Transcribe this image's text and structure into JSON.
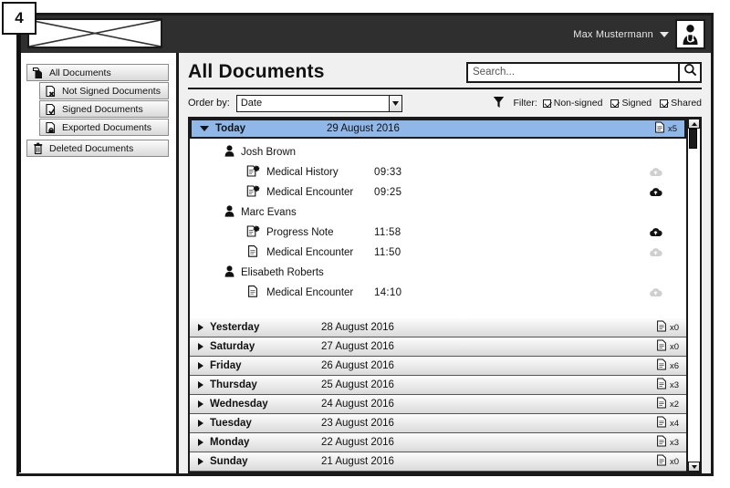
{
  "callout": {
    "number": "4"
  },
  "topbar": {
    "logo_placeholder": "image-placeholder",
    "user_name": "Max Mustermann",
    "avatar_icon": "doctor-avatar-icon",
    "caret_icon": "chevron-down-icon"
  },
  "sidebar": {
    "items": [
      {
        "label": "All Documents",
        "icon": "documents-stack-icon",
        "level": 0
      },
      {
        "label": "Not Signed Documents",
        "icon": "document-x-icon",
        "level": 1
      },
      {
        "label": "Signed Documents",
        "icon": "document-check-icon",
        "level": 1
      },
      {
        "label": "Exported Documents",
        "icon": "document-lock-icon",
        "level": 1
      },
      {
        "label": "Deleted Documents",
        "icon": "trash-bin-icon",
        "level": 0
      }
    ]
  },
  "main": {
    "page_title": "All Documents",
    "search": {
      "placeholder": "Search...",
      "value": "",
      "button_icon": "search-icon"
    },
    "order_by": {
      "label": "Order by:",
      "value": "Date",
      "arrow_icon": "chevron-down-icon"
    },
    "filter": {
      "icon": "filter-funnel-icon",
      "label": "Filter:",
      "options": [
        {
          "label": "Non-signed",
          "checked": true
        },
        {
          "label": "Signed",
          "checked": true
        },
        {
          "label": "Shared",
          "checked": true
        }
      ]
    },
    "scrollbar": {
      "up_icon": "scroll-up-icon",
      "down_icon": "scroll-down-icon"
    }
  },
  "days": [
    {
      "name": "Today",
      "date": "29 August 2016",
      "count": "x5",
      "count_icon": "document-icon",
      "expanded": true,
      "groups": [
        {
          "patient": "Josh Brown",
          "patient_icon": "person-icon",
          "documents": [
            {
              "name": "Medical History",
              "time": "09:33",
              "icon": "document-signed-icon",
              "cloud": "cloud-upload-icon",
              "shared": false
            },
            {
              "name": "Medical Encounter",
              "time": "09:25",
              "icon": "document-signed-icon",
              "cloud": "cloud-upload-icon",
              "shared": true
            }
          ]
        },
        {
          "patient": "Marc Evans",
          "patient_icon": "person-icon",
          "documents": [
            {
              "name": "Progress Note",
              "time": "11:58",
              "icon": "document-signed-icon",
              "cloud": "cloud-upload-icon",
              "shared": true
            },
            {
              "name": "Medical Encounter",
              "time": "11:50",
              "icon": "document-unsigned-icon",
              "cloud": "cloud-upload-icon",
              "shared": false
            }
          ]
        },
        {
          "patient": "Elisabeth Roberts",
          "patient_icon": "person-icon",
          "documents": [
            {
              "name": "Medical Encounter",
              "time": "14:10",
              "icon": "document-unsigned-icon",
              "cloud": "cloud-upload-icon",
              "shared": false
            }
          ]
        }
      ]
    },
    {
      "name": "Yesterday",
      "date": "28 August 2016",
      "count": "x0",
      "count_icon": "document-icon",
      "expanded": false,
      "groups": []
    },
    {
      "name": "Saturday",
      "date": "27 August 2016",
      "count": "x0",
      "count_icon": "document-icon",
      "expanded": false,
      "groups": []
    },
    {
      "name": "Friday",
      "date": "26 August 2016",
      "count": "x6",
      "count_icon": "document-icon",
      "expanded": false,
      "groups": []
    },
    {
      "name": "Thursday",
      "date": "25 August 2016",
      "count": "x3",
      "count_icon": "document-icon",
      "expanded": false,
      "groups": []
    },
    {
      "name": "Wednesday",
      "date": "24 August 2016",
      "count": "x2",
      "count_icon": "document-icon",
      "expanded": false,
      "groups": []
    },
    {
      "name": "Tuesday",
      "date": "23 August 2016",
      "count": "x4",
      "count_icon": "document-icon",
      "expanded": false,
      "groups": []
    },
    {
      "name": "Monday",
      "date": "22 August 2016",
      "count": "x3",
      "count_icon": "document-icon",
      "expanded": false,
      "groups": []
    },
    {
      "name": "Sunday",
      "date": "21 August 2016",
      "count": "x0",
      "count_icon": "document-icon",
      "expanded": false,
      "groups": []
    }
  ],
  "colors": {
    "selected_row": "#8fb8e8",
    "topbar": "#2f2f2f",
    "outline": "#1a1a1a",
    "panel_bg": "#f0f0f0"
  }
}
